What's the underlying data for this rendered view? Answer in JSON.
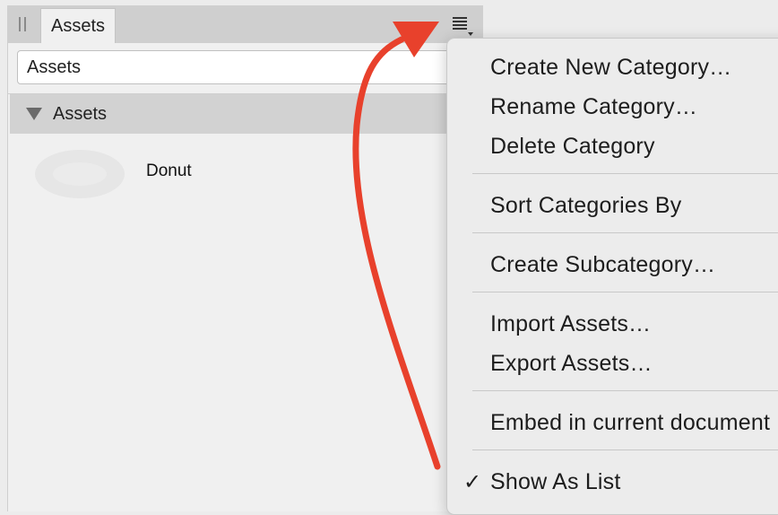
{
  "panel": {
    "tab_label": "Assets",
    "search_value": "Assets",
    "category_label": "Assets",
    "asset_name": "Donut"
  },
  "menu": {
    "create_new_category": "Create New Category…",
    "rename_category": "Rename Category…",
    "delete_category": "Delete Category",
    "sort_categories_by": "Sort Categories By",
    "create_subcategory": "Create Subcategory…",
    "import_assets": "Import Assets…",
    "export_assets": "Export Assets…",
    "embed_in_current_document": "Embed in current document",
    "show_as_list": "Show As List",
    "show_as_list_checkmark": "✓"
  },
  "colors": {
    "annotation_arrow": "#e8412c",
    "panel_bg": "#f0f0f0",
    "menu_bg": "#ececec"
  },
  "icons": [
    "grip-icon",
    "panel-menu-icon",
    "disclosure-triangle-icon",
    "donut-thumbnail",
    "checkmark-icon"
  ]
}
